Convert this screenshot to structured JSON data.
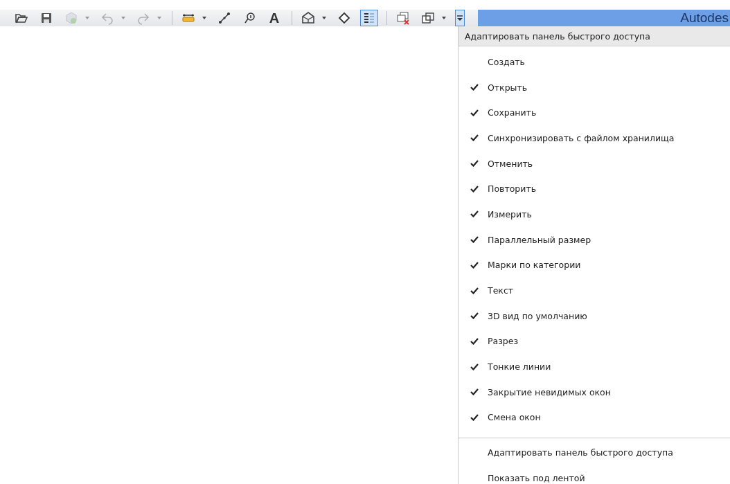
{
  "toolbar": {
    "buttons": [
      {
        "kind": "open",
        "disabled": false,
        "dropdown": false,
        "selected": false
      },
      {
        "kind": "save",
        "disabled": false,
        "dropdown": false,
        "selected": false
      },
      {
        "kind": "sync",
        "disabled": true,
        "dropdown": true,
        "selected": false
      },
      {
        "kind": "undo",
        "disabled": true,
        "dropdown": true,
        "selected": false
      },
      {
        "kind": "redo",
        "disabled": true,
        "dropdown": true,
        "selected": false
      },
      {
        "kind": "separator"
      },
      {
        "kind": "dimension",
        "disabled": false,
        "dropdown": true,
        "selected": false
      },
      {
        "kind": "measure",
        "disabled": false,
        "dropdown": false,
        "selected": false
      },
      {
        "kind": "tag",
        "disabled": false,
        "dropdown": false,
        "selected": false
      },
      {
        "kind": "text",
        "label": "A",
        "disabled": false,
        "dropdown": false,
        "selected": false
      },
      {
        "kind": "separator"
      },
      {
        "kind": "view3d",
        "disabled": false,
        "dropdown": true,
        "selected": false
      },
      {
        "kind": "section",
        "disabled": false,
        "dropdown": false,
        "selected": false
      },
      {
        "kind": "thinlines",
        "disabled": false,
        "dropdown": false,
        "selected": true
      },
      {
        "kind": "separator"
      },
      {
        "kind": "closehidden",
        "disabled": false,
        "dropdown": false,
        "selected": false
      },
      {
        "kind": "switchwindows",
        "disabled": false,
        "dropdown": true,
        "selected": false
      },
      {
        "kind": "customize",
        "disabled": false,
        "dropdown": false,
        "selected": true
      }
    ]
  },
  "title_bar": {
    "title": "Autodes"
  },
  "menu": {
    "header": "Адаптировать панель быстрого доступа",
    "items": [
      {
        "label": "Создать",
        "checked": false
      },
      {
        "label": "Открыть",
        "checked": true
      },
      {
        "label": "Сохранить",
        "checked": true
      },
      {
        "label": "Синхронизировать с файлом хранилища",
        "checked": true
      },
      {
        "label": "Отменить",
        "checked": true
      },
      {
        "label": "Повторить",
        "checked": true
      },
      {
        "label": "Измерить",
        "checked": true
      },
      {
        "label": "Параллельный размер",
        "checked": true
      },
      {
        "label": "Марки по категории",
        "checked": true
      },
      {
        "label": "Текст",
        "checked": true
      },
      {
        "label": "3D вид по умолчанию",
        "checked": true
      },
      {
        "label": "Разрез",
        "checked": true
      },
      {
        "label": "Тонкие линии",
        "checked": true
      },
      {
        "label": "Закрытие невидимых окон",
        "checked": true
      },
      {
        "label": "Смена окон",
        "checked": true
      }
    ],
    "footer_items": [
      "Адаптировать панель быстрого доступа",
      "Показать под лентой"
    ]
  }
}
